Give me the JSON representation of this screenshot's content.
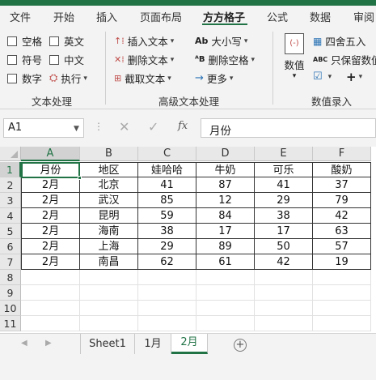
{
  "ribbon_tabs": [
    "文件",
    "开始",
    "插入",
    "页面布局",
    "方方格子",
    "公式",
    "数据",
    "审阅"
  ],
  "active_tab": "方方格子",
  "text_group": {
    "checkboxes": [
      "空格",
      "英文",
      "符号",
      "中文",
      "数字"
    ],
    "execute": "执行",
    "label": "文本处理"
  },
  "advanced_group": {
    "insert_text": "插入文本",
    "delete_text": "删除文本",
    "extract_text": "截取文本",
    "case": "大小写",
    "delete_space": "删除空格",
    "more": "更多",
    "label": "高级文本处理"
  },
  "value_group": {
    "value_button": "数值",
    "round": "四舍五入",
    "keep_value": "只保留数值",
    "label": "数值录入"
  },
  "formula_bar": {
    "name_box": "A1",
    "content": "月份",
    "fx": "fx"
  },
  "columns": [
    "A",
    "B",
    "C",
    "D",
    "E",
    "F"
  ],
  "rows": [
    "1",
    "2",
    "3",
    "4",
    "5",
    "6",
    "7",
    "8",
    "9",
    "10",
    "11"
  ],
  "table": {
    "headers": [
      "月份",
      "地区",
      "娃哈哈",
      "牛奶",
      "可乐",
      "酸奶"
    ],
    "data": [
      [
        "2月",
        "北京",
        "41",
        "87",
        "41",
        "37"
      ],
      [
        "2月",
        "武汉",
        "85",
        "12",
        "29",
        "79"
      ],
      [
        "2月",
        "昆明",
        "59",
        "84",
        "38",
        "42"
      ],
      [
        "2月",
        "海南",
        "38",
        "17",
        "17",
        "63"
      ],
      [
        "2月",
        "上海",
        "29",
        "89",
        "50",
        "57"
      ],
      [
        "2月",
        "南昌",
        "62",
        "61",
        "42",
        "19"
      ]
    ]
  },
  "sheets": [
    "Sheet1",
    "1月",
    "2月"
  ],
  "active_sheet": "2月",
  "status": {
    "left": "ᴀᴀ ᴜᴜ ᴀ ᴀ",
    "middle": "",
    "right": ""
  },
  "colors": {
    "accent": "#217346",
    "ribbon_bg": "#f3f3f3"
  }
}
